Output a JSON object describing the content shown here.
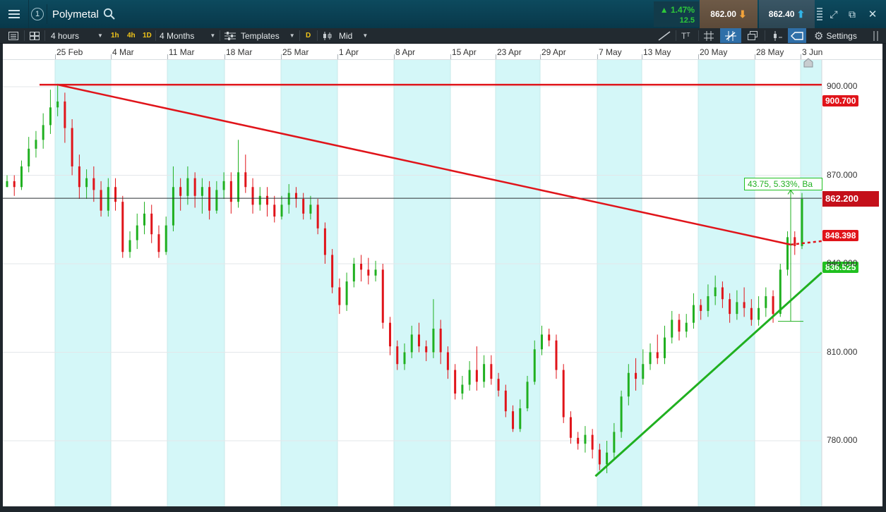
{
  "header": {
    "instrument": "Polymetal",
    "workspace_number": "1",
    "change_pct": "▲ 1.47%",
    "change_abs": "12.5",
    "sell_price": "862.00",
    "buy_price": "862.40",
    "icons": [
      "menu-icon",
      "search-icon",
      "expand-icon",
      "popout-icon",
      "close-icon"
    ]
  },
  "toolbar": {
    "interval": "4 hours",
    "quick_1h": "1h",
    "quick_4h": "4h",
    "quick_1d": "1D",
    "range": "4 Months",
    "templates": "Templates",
    "d_button": "D",
    "price_type": "Mid",
    "text_tool": "Tᵀ",
    "settings": "Settings"
  },
  "colors": {
    "up": "#20b020",
    "down": "#e0141a",
    "band": "#d4f7f8",
    "title_bar": "#0d4a5e"
  },
  "chart_data": {
    "type": "candlestick",
    "instrument": "Polymetal",
    "interval": "4 hours",
    "x_tick_labels": [
      "25 Feb",
      "4 Mar",
      "11 Mar",
      "18 Mar",
      "25 Mar",
      "1 Apr",
      "8 Apr",
      "15 Apr",
      "23 Apr",
      "29 Apr",
      "7 May",
      "13 May",
      "20 May",
      "28 May",
      "3 Jun"
    ],
    "y_ticks": [
      780,
      810,
      840,
      870,
      900
    ],
    "y_tick_labels": [
      "780.000",
      "810.000",
      "840.000",
      "870.000",
      "900.000"
    ],
    "ylim": [
      765,
      915
    ],
    "current_price": 862.2,
    "current_price_label": "862.200",
    "resistance_level": 900.7,
    "resistance_label": "900.700",
    "downtrend_line_value": 848.398,
    "downtrend_label": "848.398",
    "uptrend_line_value": 836.525,
    "uptrend_label": "836.525",
    "measure_text": "43.75, 5.33%, Ba",
    "candles": [
      {
        "o": 866,
        "c": 868,
        "h": 870,
        "l": 866
      },
      {
        "o": 868,
        "c": 866,
        "h": 870,
        "l": 863
      },
      {
        "o": 866,
        "c": 873,
        "h": 875,
        "l": 865
      },
      {
        "o": 873,
        "c": 879,
        "h": 883,
        "l": 871
      },
      {
        "o": 879,
        "c": 882,
        "h": 885,
        "l": 876
      },
      {
        "o": 882,
        "c": 887,
        "h": 891,
        "l": 879
      },
      {
        "o": 887,
        "c": 893,
        "h": 899,
        "l": 884
      },
      {
        "o": 893,
        "c": 895,
        "h": 901,
        "l": 890
      },
      {
        "o": 895,
        "c": 886,
        "h": 898,
        "l": 881
      },
      {
        "o": 886,
        "c": 873,
        "h": 889,
        "l": 870
      },
      {
        "o": 873,
        "c": 866,
        "h": 877,
        "l": 862
      },
      {
        "o": 866,
        "c": 869,
        "h": 872,
        "l": 862
      },
      {
        "o": 869,
        "c": 865,
        "h": 873,
        "l": 861
      },
      {
        "o": 865,
        "c": 858,
        "h": 868,
        "l": 856
      },
      {
        "o": 858,
        "c": 866,
        "h": 869,
        "l": 856
      },
      {
        "o": 866,
        "c": 861,
        "h": 869,
        "l": 858
      },
      {
        "o": 861,
        "c": 844,
        "h": 863,
        "l": 842
      },
      {
        "o": 844,
        "c": 848,
        "h": 851,
        "l": 842
      },
      {
        "o": 848,
        "c": 853,
        "h": 857,
        "l": 845
      },
      {
        "o": 853,
        "c": 857,
        "h": 861,
        "l": 850
      },
      {
        "o": 857,
        "c": 850,
        "h": 860,
        "l": 847
      },
      {
        "o": 850,
        "c": 844,
        "h": 853,
        "l": 842
      },
      {
        "o": 844,
        "c": 853,
        "h": 856,
        "l": 843
      },
      {
        "o": 853,
        "c": 866,
        "h": 873,
        "l": 851
      },
      {
        "o": 866,
        "c": 863,
        "h": 869,
        "l": 858
      },
      {
        "o": 863,
        "c": 869,
        "h": 873,
        "l": 860
      },
      {
        "o": 869,
        "c": 863,
        "h": 871,
        "l": 859
      },
      {
        "o": 863,
        "c": 866,
        "h": 869,
        "l": 857
      },
      {
        "o": 866,
        "c": 858,
        "h": 868,
        "l": 855
      },
      {
        "o": 858,
        "c": 865,
        "h": 868,
        "l": 857
      },
      {
        "o": 865,
        "c": 868,
        "h": 871,
        "l": 862
      },
      {
        "o": 868,
        "c": 861,
        "h": 871,
        "l": 857
      },
      {
        "o": 861,
        "c": 871,
        "h": 882,
        "l": 859
      },
      {
        "o": 871,
        "c": 866,
        "h": 877,
        "l": 864
      },
      {
        "o": 866,
        "c": 860,
        "h": 869,
        "l": 857
      },
      {
        "o": 860,
        "c": 863,
        "h": 866,
        "l": 858
      },
      {
        "o": 863,
        "c": 860,
        "h": 866,
        "l": 856
      },
      {
        "o": 860,
        "c": 856,
        "h": 863,
        "l": 854
      },
      {
        "o": 856,
        "c": 860,
        "h": 863,
        "l": 855
      },
      {
        "o": 860,
        "c": 864,
        "h": 867,
        "l": 857
      },
      {
        "o": 864,
        "c": 862,
        "h": 866,
        "l": 859
      },
      {
        "o": 862,
        "c": 857,
        "h": 864,
        "l": 855
      },
      {
        "o": 857,
        "c": 860,
        "h": 863,
        "l": 855
      },
      {
        "o": 860,
        "c": 852,
        "h": 862,
        "l": 850
      },
      {
        "o": 852,
        "c": 843,
        "h": 854,
        "l": 840
      },
      {
        "o": 843,
        "c": 832,
        "h": 845,
        "l": 830
      },
      {
        "o": 832,
        "c": 826,
        "h": 835,
        "l": 823
      },
      {
        "o": 826,
        "c": 834,
        "h": 837,
        "l": 824
      },
      {
        "o": 834,
        "c": 840,
        "h": 842,
        "l": 832
      },
      {
        "o": 840,
        "c": 838,
        "h": 843,
        "l": 834
      },
      {
        "o": 838,
        "c": 836,
        "h": 842,
        "l": 833
      },
      {
        "o": 836,
        "c": 838,
        "h": 841,
        "l": 834
      },
      {
        "o": 838,
        "c": 820,
        "h": 840,
        "l": 818
      },
      {
        "o": 820,
        "c": 812,
        "h": 822,
        "l": 809
      },
      {
        "o": 812,
        "c": 806,
        "h": 814,
        "l": 804
      },
      {
        "o": 806,
        "c": 810,
        "h": 813,
        "l": 804
      },
      {
        "o": 810,
        "c": 816,
        "h": 819,
        "l": 808
      },
      {
        "o": 816,
        "c": 812,
        "h": 820,
        "l": 810
      },
      {
        "o": 812,
        "c": 810,
        "h": 814,
        "l": 807
      },
      {
        "o": 810,
        "c": 818,
        "h": 828,
        "l": 808
      },
      {
        "o": 818,
        "c": 810,
        "h": 821,
        "l": 806
      },
      {
        "o": 810,
        "c": 804,
        "h": 812,
        "l": 801
      },
      {
        "o": 804,
        "c": 796,
        "h": 806,
        "l": 794
      },
      {
        "o": 796,
        "c": 799,
        "h": 802,
        "l": 794
      },
      {
        "o": 799,
        "c": 804,
        "h": 807,
        "l": 797
      },
      {
        "o": 804,
        "c": 800,
        "h": 812,
        "l": 797
      },
      {
        "o": 800,
        "c": 806,
        "h": 809,
        "l": 798
      },
      {
        "o": 806,
        "c": 801,
        "h": 809,
        "l": 799
      },
      {
        "o": 801,
        "c": 797,
        "h": 803,
        "l": 795
      },
      {
        "o": 797,
        "c": 790,
        "h": 799,
        "l": 788
      },
      {
        "o": 790,
        "c": 784,
        "h": 792,
        "l": 783
      },
      {
        "o": 784,
        "c": 791,
        "h": 794,
        "l": 783
      },
      {
        "o": 791,
        "c": 800,
        "h": 802,
        "l": 790
      },
      {
        "o": 800,
        "c": 811,
        "h": 814,
        "l": 799
      },
      {
        "o": 811,
        "c": 816,
        "h": 819,
        "l": 809
      },
      {
        "o": 816,
        "c": 814,
        "h": 818,
        "l": 812
      },
      {
        "o": 814,
        "c": 804,
        "h": 816,
        "l": 801
      },
      {
        "o": 804,
        "c": 788,
        "h": 806,
        "l": 786
      },
      {
        "o": 788,
        "c": 781,
        "h": 790,
        "l": 779
      },
      {
        "o": 781,
        "c": 779,
        "h": 783,
        "l": 777
      },
      {
        "o": 779,
        "c": 782,
        "h": 785,
        "l": 776
      },
      {
        "o": 782,
        "c": 777,
        "h": 784,
        "l": 774
      },
      {
        "o": 777,
        "c": 772,
        "h": 779,
        "l": 770
      },
      {
        "o": 772,
        "c": 776,
        "h": 780,
        "l": 769
      },
      {
        "o": 776,
        "c": 783,
        "h": 786,
        "l": 774
      },
      {
        "o": 783,
        "c": 795,
        "h": 797,
        "l": 781
      },
      {
        "o": 795,
        "c": 803,
        "h": 806,
        "l": 792
      },
      {
        "o": 803,
        "c": 801,
        "h": 808,
        "l": 797
      },
      {
        "o": 801,
        "c": 806,
        "h": 811,
        "l": 799
      },
      {
        "o": 806,
        "c": 810,
        "h": 813,
        "l": 804
      },
      {
        "o": 810,
        "c": 808,
        "h": 816,
        "l": 806
      },
      {
        "o": 808,
        "c": 815,
        "h": 819,
        "l": 806
      },
      {
        "o": 815,
        "c": 821,
        "h": 824,
        "l": 813
      },
      {
        "o": 821,
        "c": 817,
        "h": 823,
        "l": 814
      },
      {
        "o": 817,
        "c": 820,
        "h": 823,
        "l": 815
      },
      {
        "o": 820,
        "c": 826,
        "h": 830,
        "l": 818
      },
      {
        "o": 826,
        "c": 824,
        "h": 828,
        "l": 821
      },
      {
        "o": 824,
        "c": 829,
        "h": 833,
        "l": 822
      },
      {
        "o": 829,
        "c": 832,
        "h": 836,
        "l": 826
      },
      {
        "o": 832,
        "c": 828,
        "h": 834,
        "l": 825
      },
      {
        "o": 828,
        "c": 823,
        "h": 830,
        "l": 820
      },
      {
        "o": 823,
        "c": 827,
        "h": 831,
        "l": 821
      },
      {
        "o": 827,
        "c": 825,
        "h": 832,
        "l": 822
      },
      {
        "o": 825,
        "c": 821,
        "h": 828,
        "l": 819
      },
      {
        "o": 821,
        "c": 825,
        "h": 829,
        "l": 819
      },
      {
        "o": 825,
        "c": 829,
        "h": 832,
        "l": 822
      },
      {
        "o": 829,
        "c": 823,
        "h": 831,
        "l": 820
      },
      {
        "o": 823,
        "c": 838,
        "h": 840,
        "l": 822
      },
      {
        "o": 838,
        "c": 849,
        "h": 851,
        "l": 836
      },
      {
        "o": 849,
        "c": 846,
        "h": 851,
        "l": 843
      },
      {
        "o": 846,
        "c": 862,
        "h": 864,
        "l": 845
      }
    ]
  }
}
